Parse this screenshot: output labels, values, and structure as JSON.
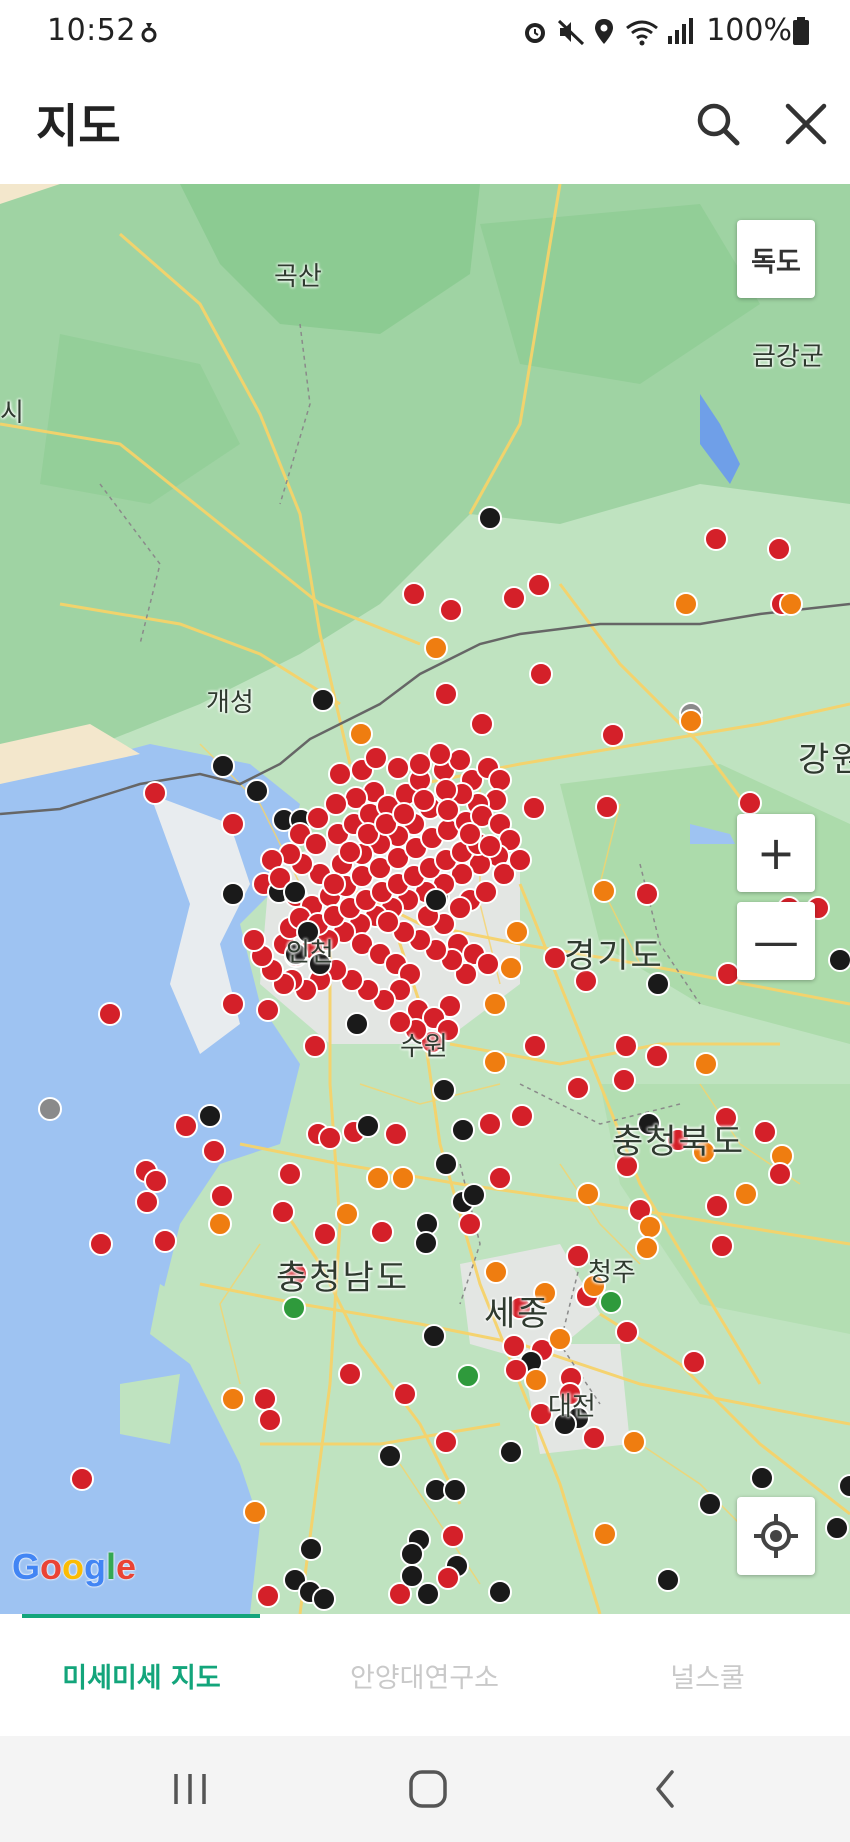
{
  "status_bar": {
    "time": "10:52",
    "battery_text": "100%",
    "icons": [
      "location-indicator-icon",
      "alarm-icon",
      "mute-icon",
      "location-icon",
      "wifi-icon",
      "signal-icon",
      "battery-icon"
    ]
  },
  "header": {
    "title": "지도",
    "search_icon": "search-icon",
    "close_icon": "close-icon"
  },
  "map": {
    "dokdo_button": "독도",
    "zoom_in": "+",
    "zoom_out": "—",
    "google_logo": "Google",
    "labels": {
      "goksan": "곡산",
      "geumgang": "금강군",
      "gaeseong": "개성",
      "gangwon": "강원",
      "gyeonggi": "경기도",
      "suwon": "수원",
      "chungbuk": "충청북도",
      "chungnam": "충청남도",
      "sejong": "세종",
      "cheongju": "청주",
      "daejeon": "대전",
      "incheon": "인천",
      "left_edge": "시"
    },
    "marker_colors": {
      "very_bad": "#d42029",
      "bad": "#ef7d10",
      "worst": "#1a1a1a",
      "good": "#2f9a3c",
      "unknown": "#8a8a8a"
    }
  },
  "tabs": [
    {
      "label": "미세미세 지도",
      "active": true
    },
    {
      "label": "안양대연구소",
      "active": false
    },
    {
      "label": "널스쿨",
      "active": false
    }
  ],
  "colors": {
    "accent": "#13a57b"
  },
  "nav_bar": {
    "icons": [
      "recent-apps-icon",
      "home-icon",
      "back-icon"
    ]
  }
}
